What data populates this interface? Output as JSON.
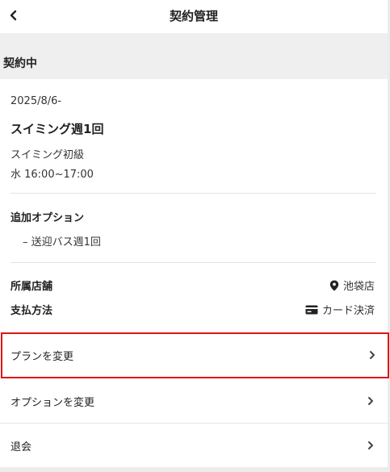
{
  "header": {
    "title": "契約管理",
    "back_icon": "chevron-left-icon"
  },
  "section": {
    "title": "契約中"
  },
  "contract": {
    "date": "2025/8/6-",
    "plan_name": "スイミング週1回",
    "course": "スイミング初級",
    "schedule": "水  16:00~17:00"
  },
  "options": {
    "title": "追加オプション",
    "items": [
      "– 送迎バス週1回"
    ]
  },
  "store": {
    "label": "所属店舗",
    "value": "池袋店",
    "icon": "location-pin-icon"
  },
  "payment": {
    "label": "支払方法",
    "value": "カード決済",
    "icon": "credit-card-icon"
  },
  "menu": [
    {
      "label": "プランを変更"
    },
    {
      "label": "オプションを変更"
    },
    {
      "label": "退会"
    }
  ],
  "colors": {
    "highlight": "#e01414",
    "section_bg": "#efefef"
  }
}
